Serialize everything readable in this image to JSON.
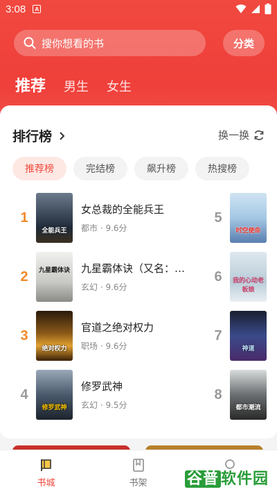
{
  "status": {
    "time": "3:08",
    "badge": "A"
  },
  "search": {
    "placeholder": "搜你想看的书",
    "category": "分类"
  },
  "tabs": [
    "推荐",
    "男生",
    "女生"
  ],
  "ranking": {
    "title": "排行榜",
    "refresh": "换一换",
    "pills": [
      "推荐榜",
      "完结榜",
      "飙升榜",
      "热搜榜"
    ],
    "books": [
      {
        "rank": "1",
        "title": "女总裁的全能兵王",
        "meta": "都市 · 9.6分",
        "cover_text": "全能兵王"
      },
      {
        "rank": "2",
        "title": "九星霸体诀（又名：…",
        "meta": "玄幻 · 9.6分",
        "cover_text": "九星霸体诀"
      },
      {
        "rank": "3",
        "title": "官道之绝对权力",
        "meta": "职场 · 9.6分",
        "cover_text": "绝对权力"
      },
      {
        "rank": "4",
        "title": "修罗武神",
        "meta": "玄幻 · 9.5分",
        "cover_text": "修罗武神"
      },
      {
        "rank": "5",
        "cover_text": "时空使命"
      },
      {
        "rank": "6",
        "cover_text": "我的心动老板娘"
      },
      {
        "rank": "7",
        "cover_text": "神道"
      },
      {
        "rank": "8",
        "cover_text": "都市潮流"
      }
    ]
  },
  "nav": {
    "bookstore": "书城",
    "bookshelf": "书架"
  },
  "watermark": {
    "g": "谷普",
    "rest": "软件园"
  },
  "colors": {
    "accent": "#ee4a3c",
    "rank_top": "#f08a2a"
  }
}
